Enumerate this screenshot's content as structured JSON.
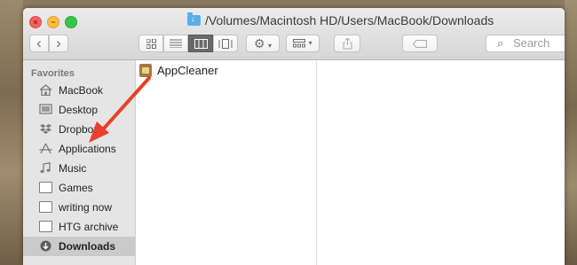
{
  "window": {
    "title": "/Volumes/Macintosh HD/Users/MacBook/Downloads",
    "title_icon": "downloads-folder-icon"
  },
  "toolbar": {
    "back_label": "‹",
    "forward_label": "›",
    "view_icons": [
      "icon-view-icon",
      "list-view-icon",
      "column-view-icon",
      "coverflow-view-icon"
    ],
    "active_view": "column",
    "action_icon": "gear-icon",
    "arrange_icon": "arrange-icon",
    "share_icon": "share-icon",
    "tags_icon": "tag-icon",
    "search_placeholder": "Search"
  },
  "sidebar": {
    "heading": "Favorites",
    "items": [
      {
        "label": "MacBook",
        "icon": "home-icon"
      },
      {
        "label": "Desktop",
        "icon": "desktop-icon"
      },
      {
        "label": "Dropbox",
        "icon": "dropbox-icon"
      },
      {
        "label": "Applications",
        "icon": "applications-icon"
      },
      {
        "label": "Music",
        "icon": "music-icon"
      },
      {
        "label": "Games",
        "icon": "folder-icon"
      },
      {
        "label": "writing now",
        "icon": "folder-icon"
      },
      {
        "label": "HTG archive",
        "icon": "folder-icon"
      },
      {
        "label": "Downloads",
        "icon": "downloads-icon",
        "selected": true
      }
    ]
  },
  "browser": {
    "column1": [
      {
        "label": "AppCleaner",
        "icon": "app-icon"
      }
    ]
  },
  "colors": {
    "annotation_arrow": "#e8402c",
    "sidebar_bg": "#e6e5e6",
    "selected_item": "#cbcacb",
    "active_segment": "#686868"
  }
}
